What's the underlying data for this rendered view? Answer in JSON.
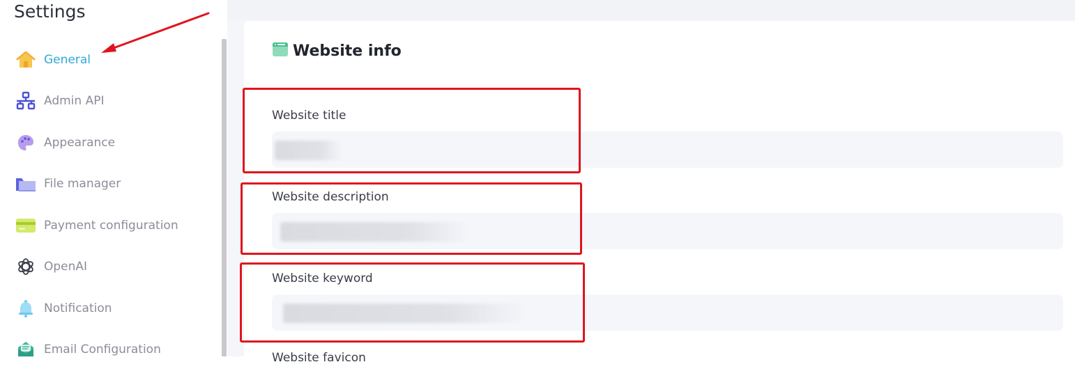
{
  "sidebar": {
    "title": "Settings",
    "items": [
      {
        "label": "General",
        "icon": "home-icon",
        "active": true
      },
      {
        "label": "Admin API",
        "icon": "network-icon"
      },
      {
        "label": "Appearance",
        "icon": "palette-icon"
      },
      {
        "label": "File manager",
        "icon": "folder-icon"
      },
      {
        "label": "Payment configuration",
        "icon": "credit-card-icon"
      },
      {
        "label": "OpenAI",
        "icon": "openai-icon"
      },
      {
        "label": "Notification",
        "icon": "bell-icon"
      },
      {
        "label": "Email Configuration",
        "icon": "mail-icon"
      }
    ]
  },
  "main": {
    "card_title": "Website info",
    "fields": [
      {
        "label": "Website title"
      },
      {
        "label": "Website description"
      },
      {
        "label": "Website keyword"
      }
    ],
    "next_field_label": "Website favicon"
  },
  "colors": {
    "accent": "#33a9d9",
    "highlight": "#e0141e",
    "nav_text": "#8b8d99"
  }
}
